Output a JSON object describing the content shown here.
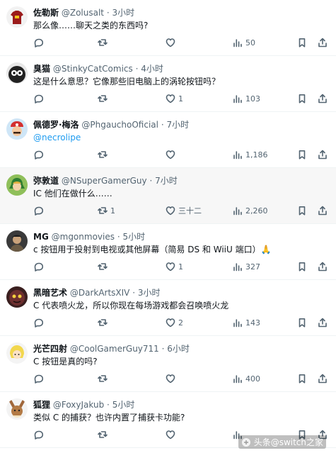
{
  "tweets": [
    {
      "name": "佐勒斯",
      "handle": "@Zolusalt",
      "sep": "·",
      "time": "3小时",
      "text": "那么像……聊天之类的东西吗?",
      "replies": "",
      "retweets": "",
      "likes": "",
      "views": "50",
      "avatar": "shirt-avatar"
    },
    {
      "name": "臭猫",
      "handle": "@StinkyCatComics",
      "sep": "·",
      "time": "4小时",
      "text": "这是什么意思？它像那些旧电脑上的涡轮按钮吗？",
      "replies": "",
      "retweets": "",
      "likes": "1",
      "views": "103",
      "avatar": "cartoon-face-avatar"
    },
    {
      "name": "佩德罗·梅洛",
      "handle": "@PhgauchoOficial",
      "sep": "·",
      "time": "7小时",
      "text": "@necrolipe",
      "replies": "",
      "retweets": "",
      "likes": "",
      "views": "1,186",
      "avatar": "mario-avatar"
    },
    {
      "name": "弥敦道",
      "handle": "@NSuperGamerGuy",
      "sep": "·",
      "time": "7小时",
      "text": "IC 他们在做什么……",
      "replies": "",
      "retweets": "1",
      "likes": "三十二",
      "views": "2,260",
      "avatar": "link-avatar"
    },
    {
      "name": "MG",
      "handle": "@mgonmovies",
      "sep": "·",
      "time": "5小时",
      "text": "c 按钮用于投射到电视或其他屏幕（简易 DS 和 WiiU 端口）🙏",
      "replies": "",
      "retweets": "",
      "likes": "1",
      "views": "327",
      "avatar": "person-avatar"
    },
    {
      "name": "黑暗艺术",
      "handle": "@DarkArtsXIV",
      "sep": "·",
      "time": "3小时",
      "text": "C 代表喷火龙，所以你现在每场游戏都会召唤喷火龙",
      "replies": "",
      "retweets": "",
      "likes": "2",
      "views": "143",
      "avatar": "dark-creature-avatar"
    },
    {
      "name": "光芒四射",
      "handle": "@CoolGamerGuy711",
      "sep": "·",
      "time": "6小时",
      "text": "C 按钮是真的吗?",
      "replies": "",
      "retweets": "",
      "likes": "",
      "views": "400",
      "avatar": "anime-avatar"
    },
    {
      "name": "狐狸",
      "handle": "@FoxyJakub",
      "sep": "·",
      "time": "5小时",
      "text": "类似 C 的捕获？也许内置了捕获卡功能?",
      "replies": "",
      "retweets": "",
      "likes": "",
      "views": "",
      "avatar": "eevee-avatar"
    }
  ],
  "watermark": "头条@switch之家"
}
